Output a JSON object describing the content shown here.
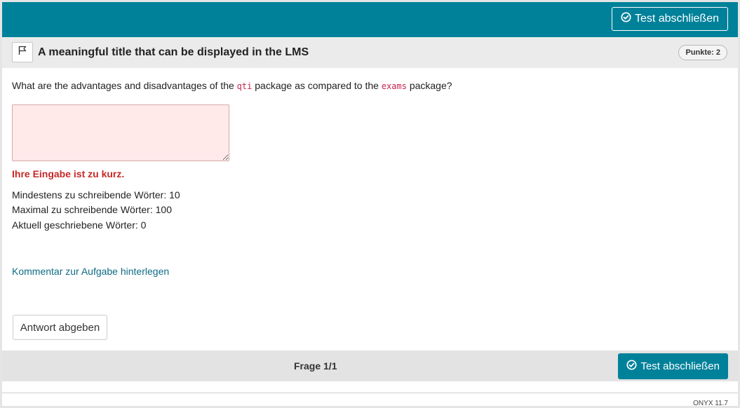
{
  "header": {
    "finish_button_label": "Test abschließen"
  },
  "item": {
    "title": "A meaningful title that can be displayed in the LMS",
    "points_badge": "Punkte: 2",
    "question": {
      "part1": "What are the advantages and disadvantages of the ",
      "code1": "qti",
      "part2": " package as compared to the ",
      "code2": "exams",
      "part3": " package?"
    },
    "answer_value": "",
    "validation_error": "Ihre Eingabe ist zu kurz.",
    "word_info": {
      "min_words": "Mindestens zu schreibende Wörter: 10",
      "max_words": "Maximal zu schreibende Wörter: 100",
      "current_words": "Aktuell geschriebene Wörter: 0"
    },
    "comment_link": "Kommentar zur Aufgabe hinterlegen",
    "submit_button_label": "Antwort abgeben"
  },
  "footer": {
    "question_counter": "Frage 1/1",
    "finish_button_label": "Test abschließen",
    "version": "ONYX 11.7"
  },
  "colors": {
    "brand": "#00819a",
    "error": "#c62828",
    "answer_error_bg": "#ffe9e9",
    "link": "#0e6b85",
    "code": "#c7254e"
  },
  "icons": {
    "finish": "check-circle-icon",
    "mark": "flag-icon"
  }
}
